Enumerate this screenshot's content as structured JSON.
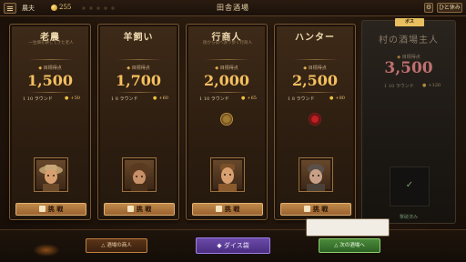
{
  "header": {
    "player_name": "農夫",
    "coins": "255",
    "title": "田舎酒場",
    "settings_icon": "gear-icon",
    "rest_label": "ひと休み"
  },
  "cards": [
    {
      "name": "老農",
      "description": "一生畑を耕してきた老人",
      "target_label": "目標得点",
      "score": "1,500",
      "rounds": "1 10 ラウンド",
      "reward": "+50",
      "special_label": "",
      "button": "挑 戦",
      "portrait_icon": "old-farmer-portrait-icon"
    },
    {
      "name": "羊飼い",
      "description": "",
      "target_label": "目標得点",
      "score": "1,700",
      "rounds": "1 8 ラウンド",
      "reward": "+60",
      "special_label": "",
      "button": "挑 戦",
      "portrait_icon": "shepherd-portrait-icon"
    },
    {
      "name": "行商人",
      "description": "街から街へ渡り歩く行商人",
      "target_label": "目標得点",
      "score": "2,000",
      "rounds": "1 10 ラウンド",
      "reward": "+65",
      "special_label": "",
      "button": "挑 戦",
      "portrait_icon": "merchant-portrait-icon"
    },
    {
      "name": "ハンター",
      "description": "",
      "target_label": "目標得点",
      "score": "2,500",
      "rounds": "1 8 ラウンド",
      "reward": "+80",
      "special_label": "",
      "button": "挑 戦",
      "portrait_icon": "hunter-portrait-icon"
    }
  ],
  "boss": {
    "tag": "ボス",
    "name": "村の酒場主人",
    "target_label": "目標得点",
    "score": "3,500",
    "rounds": "1 10 ラウンド",
    "reward": "+120",
    "status": "撃破済み"
  },
  "footer": {
    "merchant_button": "△ 酒場の商人",
    "dice_button": "◆ ダイス袋",
    "next_button": "△ 次の酒場へ",
    "tooltip": ""
  }
}
